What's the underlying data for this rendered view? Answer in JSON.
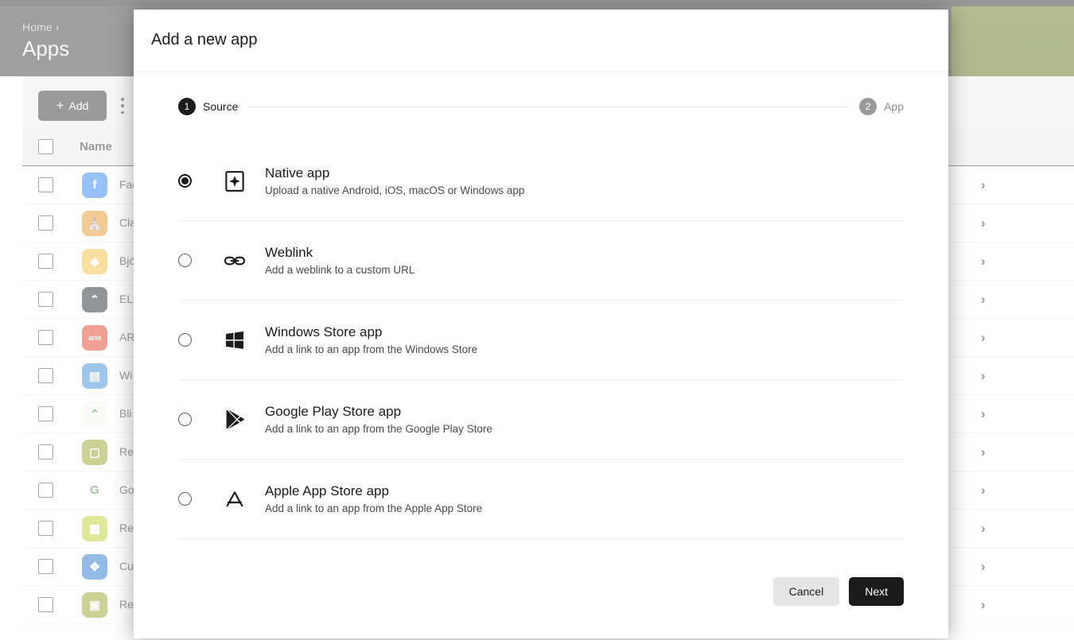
{
  "background": {
    "breadcrumb": {
      "home_label": "Home",
      "separator": "›"
    },
    "page_title": "Apps",
    "toolbar": {
      "add_label": "Add",
      "add_plus_glyph": "+",
      "overflow_menu_name": "more-options-icon"
    },
    "table": {
      "header_name": "Name",
      "row_chevron_glyph": "›",
      "rows": [
        {
          "name": "Fac",
          "icon_name": "facebook-icon",
          "icon_color": "#1877f2",
          "icon_glyph": "f"
        },
        {
          "name": "Cla Ma",
          "icon_name": "church-icon",
          "icon_color": "#e08a14",
          "icon_glyph": "⛪"
        },
        {
          "name": "Bjö",
          "icon_name": "bjorn-icon",
          "icon_color": "#f0b52a",
          "icon_glyph": "◈"
        },
        {
          "name": "ELE",
          "icon_name": "chevrons-dark-icon",
          "icon_color": "#0c1414",
          "icon_glyph": "⌃"
        },
        {
          "name": "AR",
          "icon_name": "arte-icon",
          "icon_color": "#e03010",
          "icon_glyph": "arte"
        },
        {
          "name": "Wi",
          "icon_name": "notepad-icon",
          "icon_color": "#2b7fd4",
          "icon_glyph": "▤"
        },
        {
          "name": "Bli",
          "icon_name": "chevrons-green-icon",
          "icon_color": "#f4f6f0",
          "icon_glyph": "⌃"
        },
        {
          "name": "Re",
          "icon_name": "folder-olive-icon",
          "icon_color": "#8a9c18",
          "icon_glyph": "▢"
        },
        {
          "name": "Go",
          "icon_name": "google-icon",
          "icon_color": "#ffffff",
          "icon_glyph": "G"
        },
        {
          "name": "Re",
          "icon_name": "qr-green-icon",
          "icon_color": "#b5c91a",
          "icon_glyph": "▩"
        },
        {
          "name": "Cu",
          "icon_name": "cu-blue-icon",
          "icon_color": "#1666c8",
          "icon_glyph": "✥"
        },
        {
          "name": "Re",
          "icon_name": "re-olive-icon",
          "icon_color": "#8a9c18",
          "icon_glyph": "▣"
        }
      ]
    }
  },
  "modal": {
    "title": "Add a new app",
    "stepper": {
      "steps": [
        {
          "number": "1",
          "label": "Source",
          "state": "active"
        },
        {
          "number": "2",
          "label": "App",
          "state": "inactive"
        }
      ]
    },
    "options": [
      {
        "id": "native-app",
        "icon_name": "native-app-icon",
        "title": "Native app",
        "description": "Upload a native Android, iOS, macOS or Windows app",
        "selected": true
      },
      {
        "id": "weblink",
        "icon_name": "link-icon",
        "title": "Weblink",
        "description": "Add a weblink to a custom URL",
        "selected": false
      },
      {
        "id": "windows-store-app",
        "icon_name": "windows-icon",
        "title": "Windows Store app",
        "description": "Add a link to an app from the Windows Store",
        "selected": false
      },
      {
        "id": "google-play-store-app",
        "icon_name": "google-play-icon",
        "title": "Google Play Store app",
        "description": "Add a link to an app from the Google Play Store",
        "selected": false
      },
      {
        "id": "apple-app-store-app",
        "icon_name": "apple-app-store-icon",
        "title": "Apple App Store app",
        "description": "Add a link to an app from the Apple App Store",
        "selected": false
      }
    ],
    "footer": {
      "cancel_label": "Cancel",
      "next_label": "Next"
    }
  },
  "colors": {
    "accent_dark": "#1b1b1b",
    "inactive_gray": "#9a9a9a",
    "divider": "#ededed",
    "banner_olive": "#5b6a09"
  }
}
